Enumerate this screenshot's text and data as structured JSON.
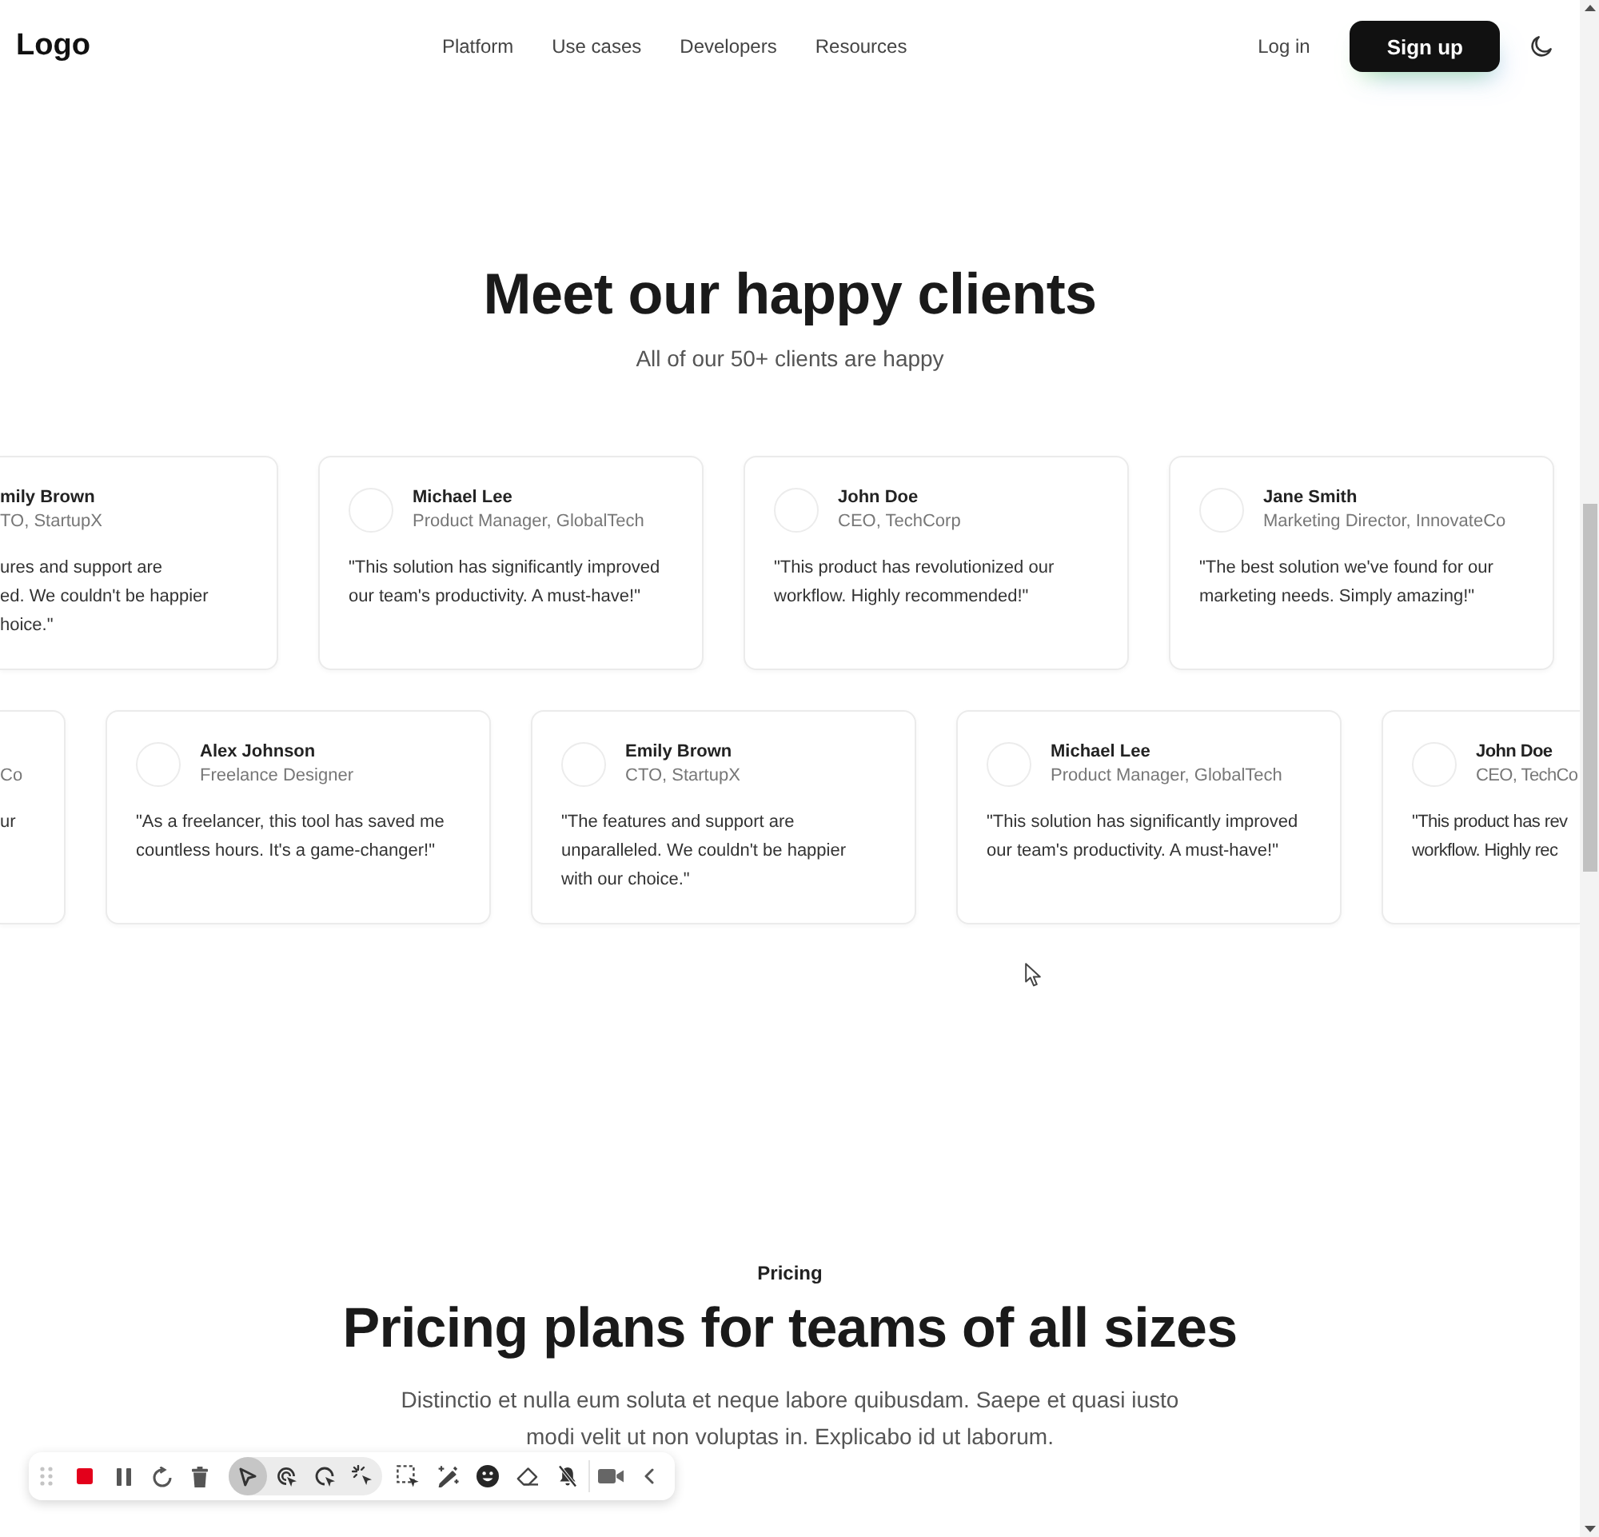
{
  "header": {
    "logo": "Logo",
    "nav": [
      {
        "label": "Platform"
      },
      {
        "label": "Use cases"
      },
      {
        "label": "Developers"
      },
      {
        "label": "Resources"
      }
    ],
    "login": "Log in",
    "signup": "Sign up"
  },
  "testimonials": {
    "title": "Meet our happy clients",
    "subtitle": "All of our 50+ clients are happy",
    "rows": [
      {
        "cards": [
          {
            "kind": "cut_left",
            "name": "mily Brown",
            "role": "TO, StartupX",
            "quote_lines": [
              "ures and support are",
              "ed. We couldn't be happier",
              "hoice.\""
            ]
          },
          {
            "kind": "full",
            "name": "Michael Lee",
            "role": "Product Manager, GlobalTech",
            "quote": "\"This solution has significantly improved our team's productivity. A must-have!\""
          },
          {
            "kind": "full",
            "name": "John Doe",
            "role": "CEO, TechCorp",
            "quote": "\"This product has revolutionized our workflow. Highly recommended!\""
          },
          {
            "kind": "full",
            "name": "Jane Smith",
            "role": "Marketing Director, InnovateCo",
            "quote": "\"The best solution we've found for our marketing needs. Simply amazing!\""
          }
        ]
      },
      {
        "cards": [
          {
            "kind": "cut_left",
            "role": "Co",
            "quote_lines": [
              "ur"
            ]
          },
          {
            "kind": "full",
            "name": "Alex Johnson",
            "role": "Freelance Designer",
            "quote": "\"As a freelancer, this tool has saved me countless hours. It's a game-changer!\""
          },
          {
            "kind": "full",
            "name": "Emily Brown",
            "role": "CTO, StartupX",
            "quote": "\"The features and support are unparalleled. We couldn't be happier with our choice.\""
          },
          {
            "kind": "full",
            "name": "Michael Lee",
            "role": "Product Manager, GlobalTech",
            "quote": "\"This solution has significantly improved our team's productivity. A must-have!\""
          },
          {
            "kind": "cut_right",
            "name": "John Doe",
            "role": "CEO, TechCo",
            "quote_lines": [
              "\"This product has rev",
              "workflow. Highly rec"
            ]
          }
        ]
      }
    ]
  },
  "pricing": {
    "eyebrow": "Pricing",
    "title": "Pricing plans for teams of all sizes",
    "description": "Distinctio et nulla eum soluta et neque labore quibusdam. Saepe et quasi iusto modi velit ut non voluptas in. Explicabo id ut laborum."
  },
  "recorder_toolbar": {
    "cursor_modes": [
      {
        "selected": true
      },
      {
        "selected": false
      },
      {
        "selected": false
      },
      {
        "selected": false
      }
    ]
  }
}
